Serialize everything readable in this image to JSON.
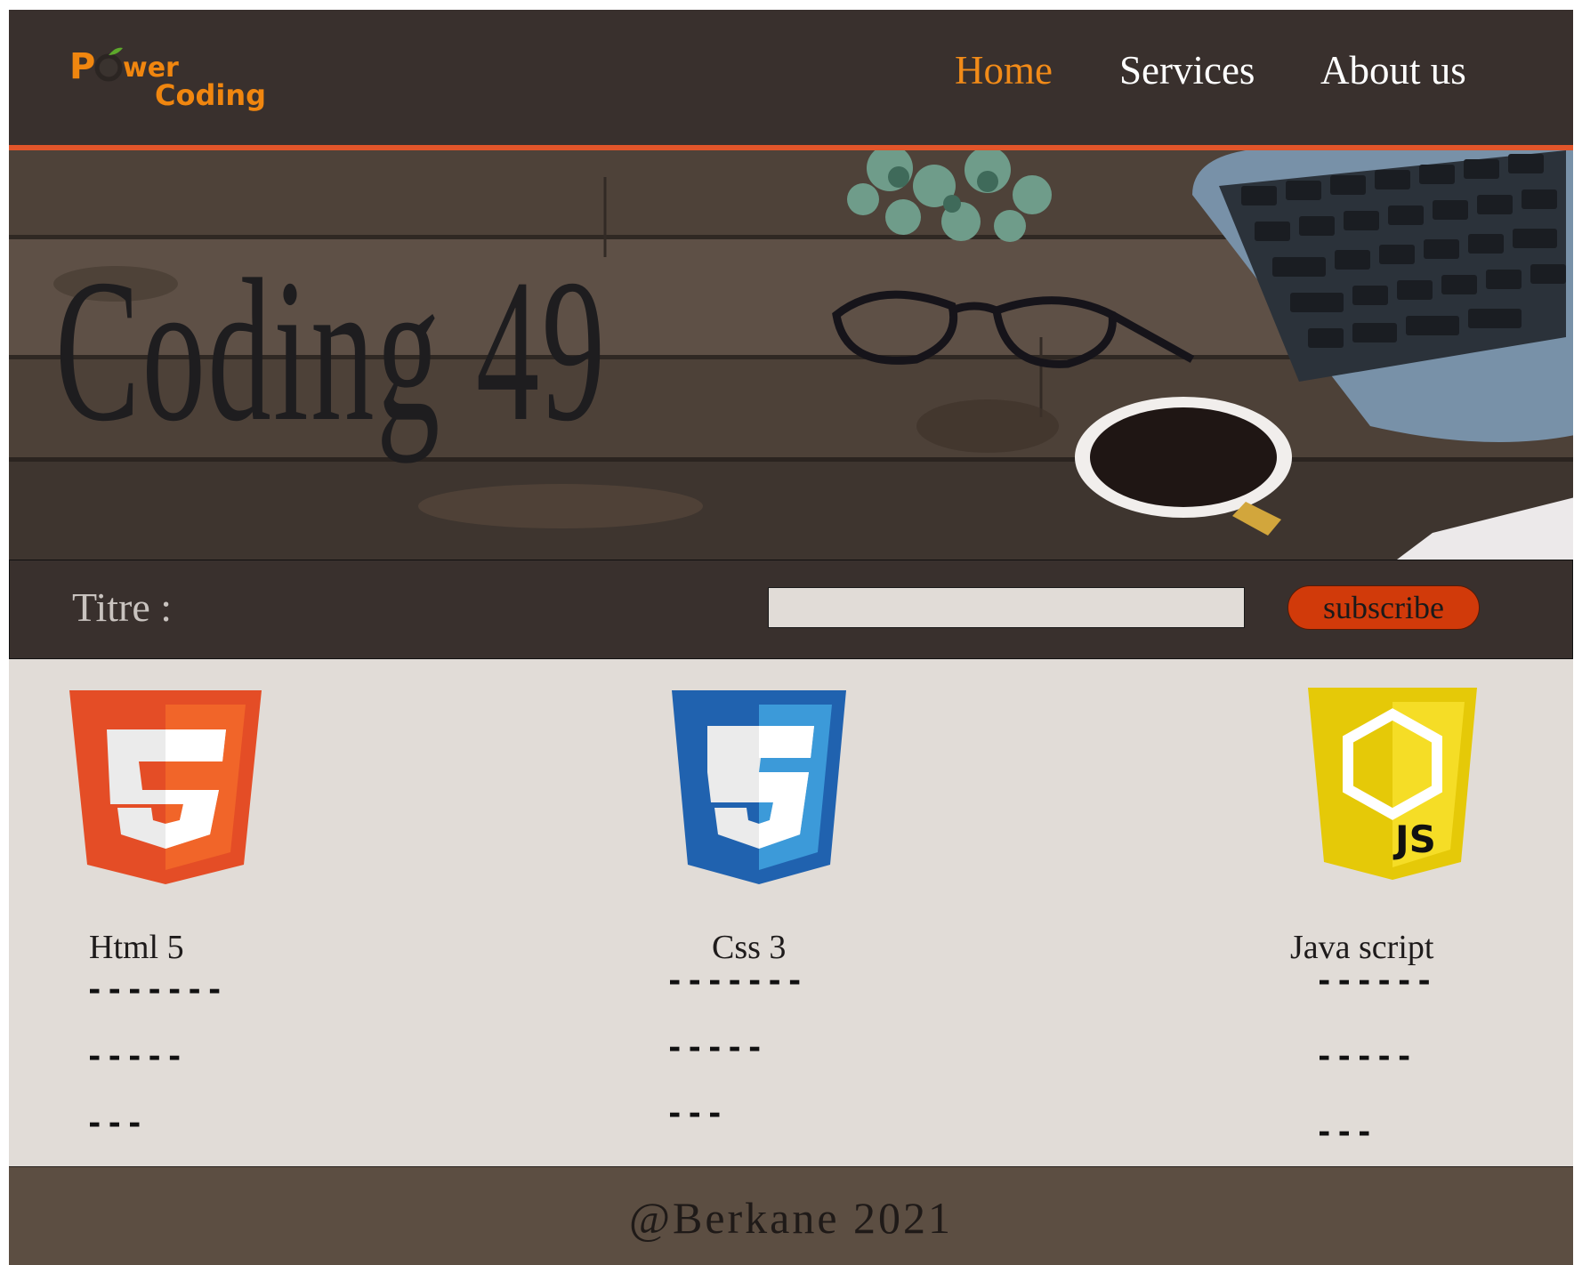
{
  "header": {
    "logo": {
      "word_top": "Power",
      "word_bottom": "Coding"
    },
    "nav": [
      {
        "label": "Home",
        "active": true
      },
      {
        "label": "Services",
        "active": false
      },
      {
        "label": "About us",
        "active": false
      }
    ]
  },
  "hero": {
    "title": "Coding  49"
  },
  "subscribe": {
    "label": "Titre :",
    "input_value": "",
    "button_label": "subscribe"
  },
  "technologies": [
    {
      "name": "Html 5",
      "icon": "html5-logo-icon",
      "lines": [
        "-------",
        "-----",
        "---"
      ]
    },
    {
      "name": "Css 3",
      "icon": "css3-logo-icon",
      "lines": [
        "-------",
        "-----",
        "---"
      ]
    },
    {
      "name": "Java script",
      "icon": "javascript-logo-icon",
      "lines": [
        "------",
        "-----",
        "---"
      ]
    }
  ],
  "footer": {
    "text": "@Berkane 2021"
  },
  "colors": {
    "header_bg": "#39302d",
    "accent_line": "#e2552a",
    "nav_active": "#f28b18",
    "button_bg": "#d13a0a",
    "content_bg": "#e1dcd7",
    "footer_bg": "#5c4e42"
  }
}
